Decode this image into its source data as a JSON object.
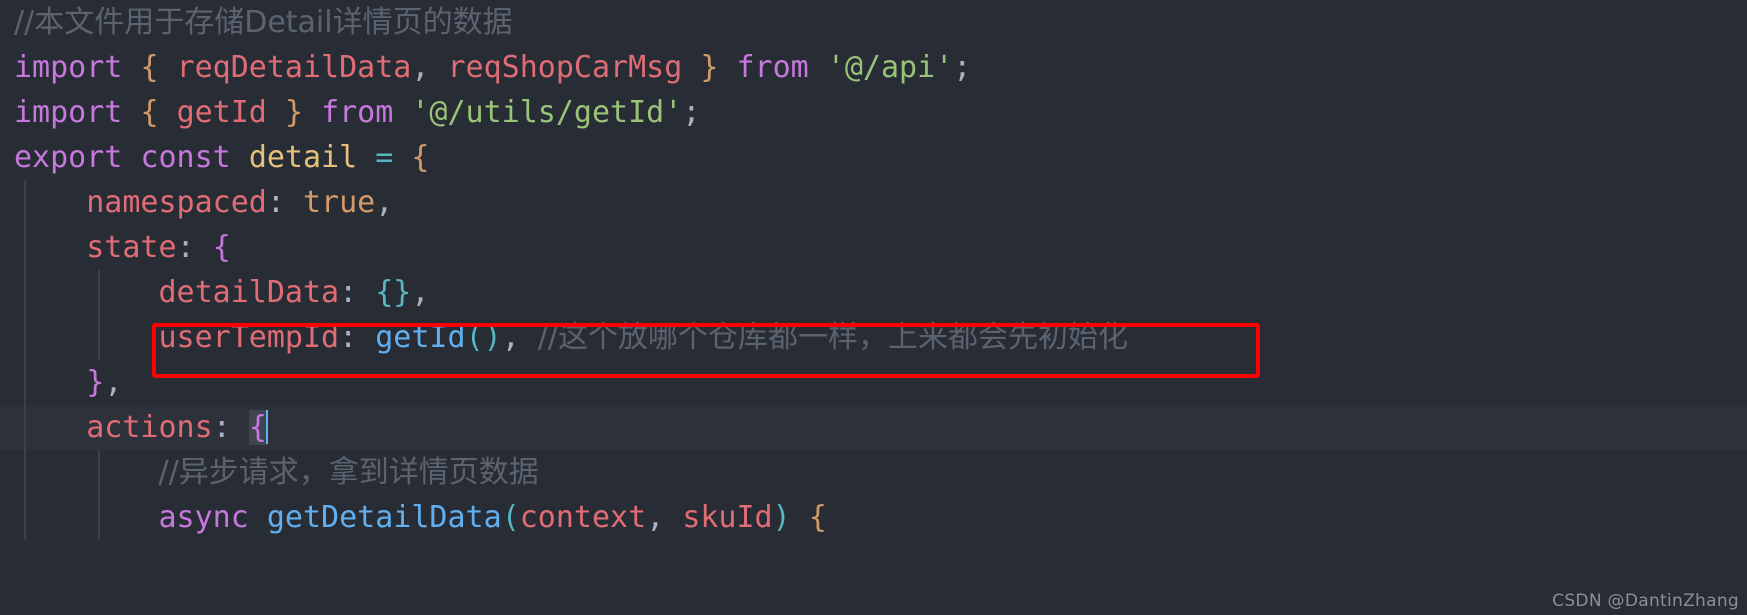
{
  "editor": {
    "theme_background": "#282c34",
    "current_line_background": "#2c313a",
    "annotation_color": "#ff0000",
    "lines": [
      {
        "id": "line-comment-header",
        "indent": 0,
        "current": false,
        "guides": [],
        "tokens": [
          {
            "cls": "t-comment cjk",
            "text": "//本文件用于存储Detail详情页的数据"
          }
        ]
      },
      {
        "id": "line-import-api",
        "indent": 0,
        "current": false,
        "guides": [],
        "tokens": [
          {
            "cls": "t-kw",
            "text": "import"
          },
          {
            "cls": "t-punct",
            "text": " "
          },
          {
            "cls": "t-brace-y",
            "text": "{"
          },
          {
            "cls": "t-punct",
            "text": " "
          },
          {
            "cls": "t-var",
            "text": "reqDetailData"
          },
          {
            "cls": "t-punct",
            "text": ", "
          },
          {
            "cls": "t-var",
            "text": "reqShopCarMsg"
          },
          {
            "cls": "t-punct",
            "text": " "
          },
          {
            "cls": "t-brace-y",
            "text": "}"
          },
          {
            "cls": "t-punct",
            "text": " "
          },
          {
            "cls": "t-kw",
            "text": "from"
          },
          {
            "cls": "t-punct",
            "text": " "
          },
          {
            "cls": "t-str",
            "text": "'@/api'"
          },
          {
            "cls": "t-punct",
            "text": ";"
          }
        ]
      },
      {
        "id": "line-import-getid",
        "indent": 0,
        "current": false,
        "guides": [],
        "tokens": [
          {
            "cls": "t-kw",
            "text": "import"
          },
          {
            "cls": "t-punct",
            "text": " "
          },
          {
            "cls": "t-brace-y",
            "text": "{"
          },
          {
            "cls": "t-punct",
            "text": " "
          },
          {
            "cls": "t-var",
            "text": "getId"
          },
          {
            "cls": "t-punct",
            "text": " "
          },
          {
            "cls": "t-brace-y",
            "text": "}"
          },
          {
            "cls": "t-punct",
            "text": " "
          },
          {
            "cls": "t-kw",
            "text": "from"
          },
          {
            "cls": "t-punct",
            "text": " "
          },
          {
            "cls": "t-str",
            "text": "'@/utils/getId'"
          },
          {
            "cls": "t-punct",
            "text": ";"
          }
        ]
      },
      {
        "id": "line-export-const-detail",
        "indent": 0,
        "current": false,
        "guides": [],
        "tokens": [
          {
            "cls": "t-kw",
            "text": "export"
          },
          {
            "cls": "t-punct",
            "text": " "
          },
          {
            "cls": "t-kw",
            "text": "const"
          },
          {
            "cls": "t-punct",
            "text": " "
          },
          {
            "cls": "t-entity",
            "text": "detail"
          },
          {
            "cls": "t-punct",
            "text": " "
          },
          {
            "cls": "t-op",
            "text": "="
          },
          {
            "cls": "t-punct",
            "text": " "
          },
          {
            "cls": "t-brace-y",
            "text": "{"
          }
        ]
      },
      {
        "id": "line-namespaced",
        "indent": 1,
        "current": false,
        "guides": [
          "g1"
        ],
        "tokens": [
          {
            "cls": "t-punct",
            "text": "    "
          },
          {
            "cls": "t-prop",
            "text": "namespaced"
          },
          {
            "cls": "t-punct",
            "text": ": "
          },
          {
            "cls": "t-const",
            "text": "true"
          },
          {
            "cls": "t-punct",
            "text": ","
          }
        ]
      },
      {
        "id": "line-state-open",
        "indent": 1,
        "current": false,
        "guides": [
          "g1"
        ],
        "tokens": [
          {
            "cls": "t-punct",
            "text": "    "
          },
          {
            "cls": "t-prop",
            "text": "state"
          },
          {
            "cls": "t-punct",
            "text": ": "
          },
          {
            "cls": "t-brace-p",
            "text": "{"
          }
        ]
      },
      {
        "id": "line-detaildata",
        "indent": 2,
        "current": false,
        "guides": [
          "g1",
          "g2"
        ],
        "tokens": [
          {
            "cls": "t-punct",
            "text": "        "
          },
          {
            "cls": "t-prop",
            "text": "detailData"
          },
          {
            "cls": "t-punct",
            "text": ": "
          },
          {
            "cls": "t-brace-c",
            "text": "{}"
          },
          {
            "cls": "t-punct",
            "text": ","
          }
        ]
      },
      {
        "id": "line-usertempid",
        "indent": 2,
        "current": false,
        "guides": [
          "g1",
          "g2"
        ],
        "tokens": [
          {
            "cls": "t-punct",
            "text": "        "
          },
          {
            "cls": "t-prop",
            "text": "userTempId"
          },
          {
            "cls": "t-punct",
            "text": ": "
          },
          {
            "cls": "t-func",
            "text": "getId"
          },
          {
            "cls": "t-brace-c",
            "text": "()"
          },
          {
            "cls": "t-punct",
            "text": ", "
          },
          {
            "cls": "t-comment cjk",
            "text": "//这个放哪个仓库都一样，上来都会先初始化"
          }
        ]
      },
      {
        "id": "line-state-close",
        "indent": 1,
        "current": false,
        "guides": [
          "g1"
        ],
        "tokens": [
          {
            "cls": "t-punct",
            "text": "    "
          },
          {
            "cls": "t-brace-p",
            "text": "}"
          },
          {
            "cls": "t-punct",
            "text": ","
          }
        ]
      },
      {
        "id": "line-actions-open",
        "indent": 1,
        "current": true,
        "guides": [
          "g1"
        ],
        "tokens": [
          {
            "cls": "t-punct",
            "text": "    "
          },
          {
            "cls": "t-prop",
            "text": "actions"
          },
          {
            "cls": "t-punct",
            "text": ": "
          },
          {
            "cls": "t-brace-p sel",
            "text": "{"
          },
          {
            "cls": "caret",
            "text": ""
          }
        ]
      },
      {
        "id": "line-comment-async",
        "indent": 2,
        "current": false,
        "guides": [
          "g1",
          "g2"
        ],
        "tokens": [
          {
            "cls": "t-punct",
            "text": "        "
          },
          {
            "cls": "t-comment cjk",
            "text": "//异步请求，拿到详情页数据"
          }
        ]
      },
      {
        "id": "line-getdetaildata",
        "indent": 2,
        "current": false,
        "guides": [
          "g1",
          "g2"
        ],
        "tokens": [
          {
            "cls": "t-punct",
            "text": "        "
          },
          {
            "cls": "t-kw",
            "text": "async"
          },
          {
            "cls": "t-punct",
            "text": " "
          },
          {
            "cls": "t-func",
            "text": "getDetailData"
          },
          {
            "cls": "t-brace-c",
            "text": "("
          },
          {
            "cls": "t-var",
            "text": "context"
          },
          {
            "cls": "t-punct",
            "text": ", "
          },
          {
            "cls": "t-var",
            "text": "skuId"
          },
          {
            "cls": "t-brace-c",
            "text": ")"
          },
          {
            "cls": "t-punct",
            "text": " "
          },
          {
            "cls": "t-brace-y",
            "text": "{"
          }
        ]
      }
    ]
  },
  "annotation": {
    "name": "red-highlight-box",
    "targets_line": "line-usertempid"
  },
  "watermark": {
    "text": "CSDN @DantinZhang"
  }
}
